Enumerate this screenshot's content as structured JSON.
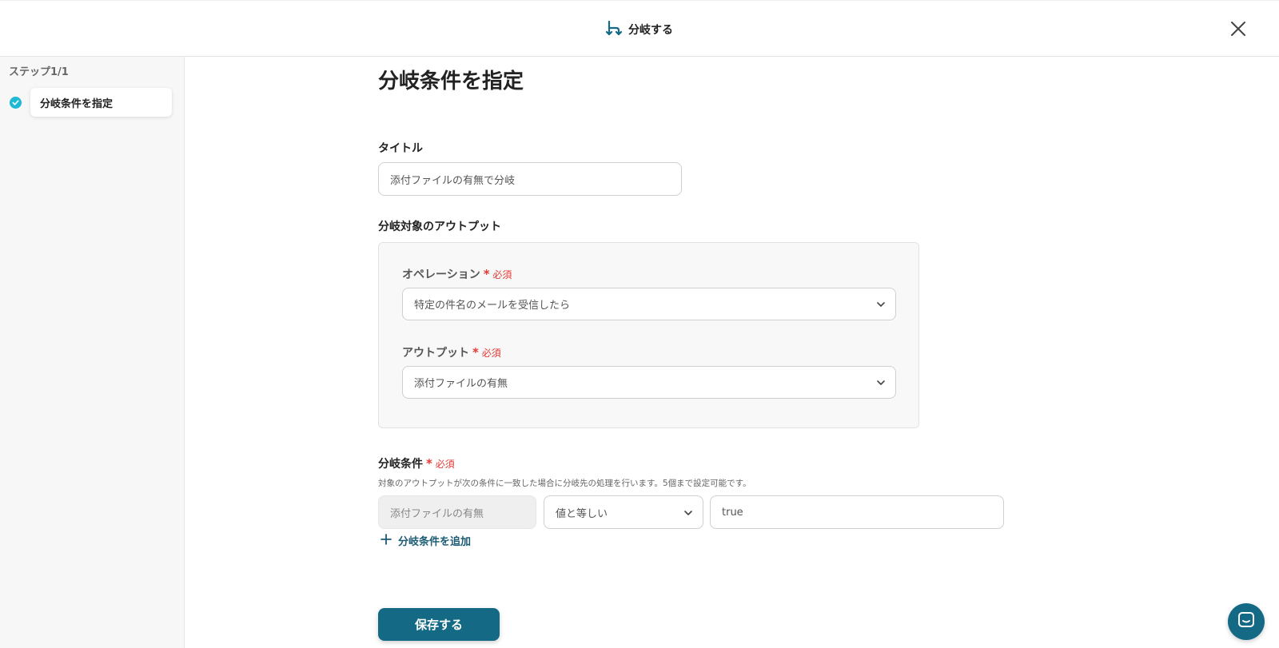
{
  "header": {
    "title": "分岐する",
    "icon": "branch-icon"
  },
  "sidebar": {
    "step_count": "ステップ1/1",
    "steps": [
      {
        "label": "分岐条件を指定",
        "status": "completed"
      }
    ]
  },
  "main": {
    "page_title": "分岐条件を指定",
    "title_field": {
      "label": "タイトル",
      "value": "添付ファイルの有無で分岐"
    },
    "output_section": {
      "label": "分岐対象のアウトプット",
      "operation": {
        "label": "オペレーション",
        "required": "必須",
        "value": "特定の件名のメールを受信したら"
      },
      "output": {
        "label": "アウトプット",
        "required": "必須",
        "value": "添付ファイルの有無"
      }
    },
    "conditions": {
      "label": "分岐条件",
      "required": "必須",
      "help": "対象のアウトプットが次の条件に一致した場合に分岐先の処理を行います。5個まで設定可能です。",
      "row": {
        "field": "添付ファイルの有無",
        "operator": "値と等しい",
        "value": "true"
      },
      "add_label": "分岐条件を追加"
    },
    "save_label": "保存する"
  },
  "colors": {
    "accent": "#146a84",
    "required": "#e53935",
    "check": "#1fb9d6"
  }
}
